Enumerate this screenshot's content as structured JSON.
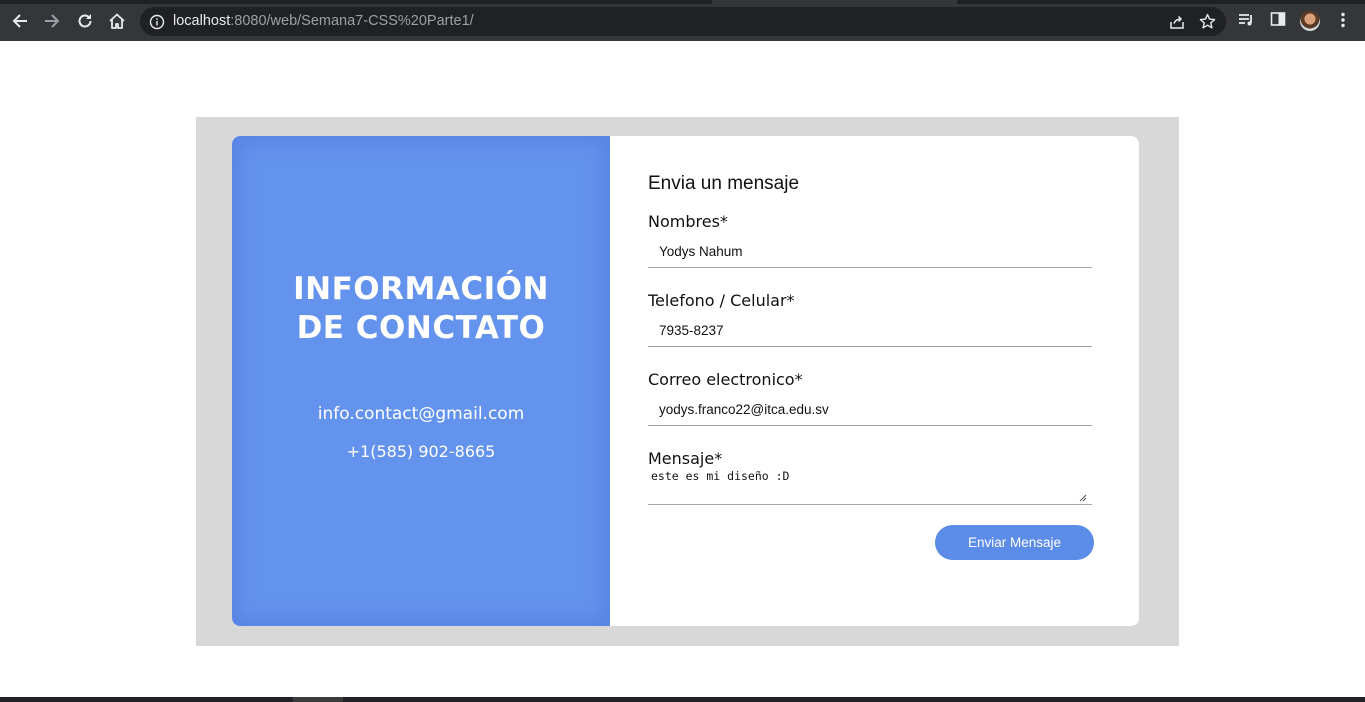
{
  "browser": {
    "url_host": "localhost",
    "url_rest": ":8080/web/Semana7-CSS%20Parte1/",
    "icons": [
      "back-icon",
      "forward-icon",
      "reload-icon",
      "home-icon",
      "info-icon",
      "share-icon",
      "star-icon",
      "reading-list-icon",
      "side-panel-icon",
      "avatar",
      "kebab-menu-icon"
    ]
  },
  "contact_info": {
    "title_line1": "INFORMACIÓN",
    "title_line2": "DE CONCTATO",
    "email": "info.contact@gmail.com",
    "phone": "+1(585) 902-8665"
  },
  "form": {
    "title": "Envia un mensaje",
    "fields": [
      {
        "label": "Nombres*",
        "value": "Yodys Nahum"
      },
      {
        "label": "Telefono / Celular*",
        "value": "7935-8237"
      },
      {
        "label": "Correo electronico*",
        "value": "yodys.franco22@itca.edu.sv"
      },
      {
        "label": "Mensaje*",
        "value": "este es mi diseño :D"
      }
    ],
    "submit_label": "Enviar Mensaje"
  },
  "colors": {
    "panel_blue": "#6493ed",
    "button_blue": "#5b8ce8",
    "outer_gray": "#d8d8d8",
    "chrome_dark": "#35363a"
  }
}
